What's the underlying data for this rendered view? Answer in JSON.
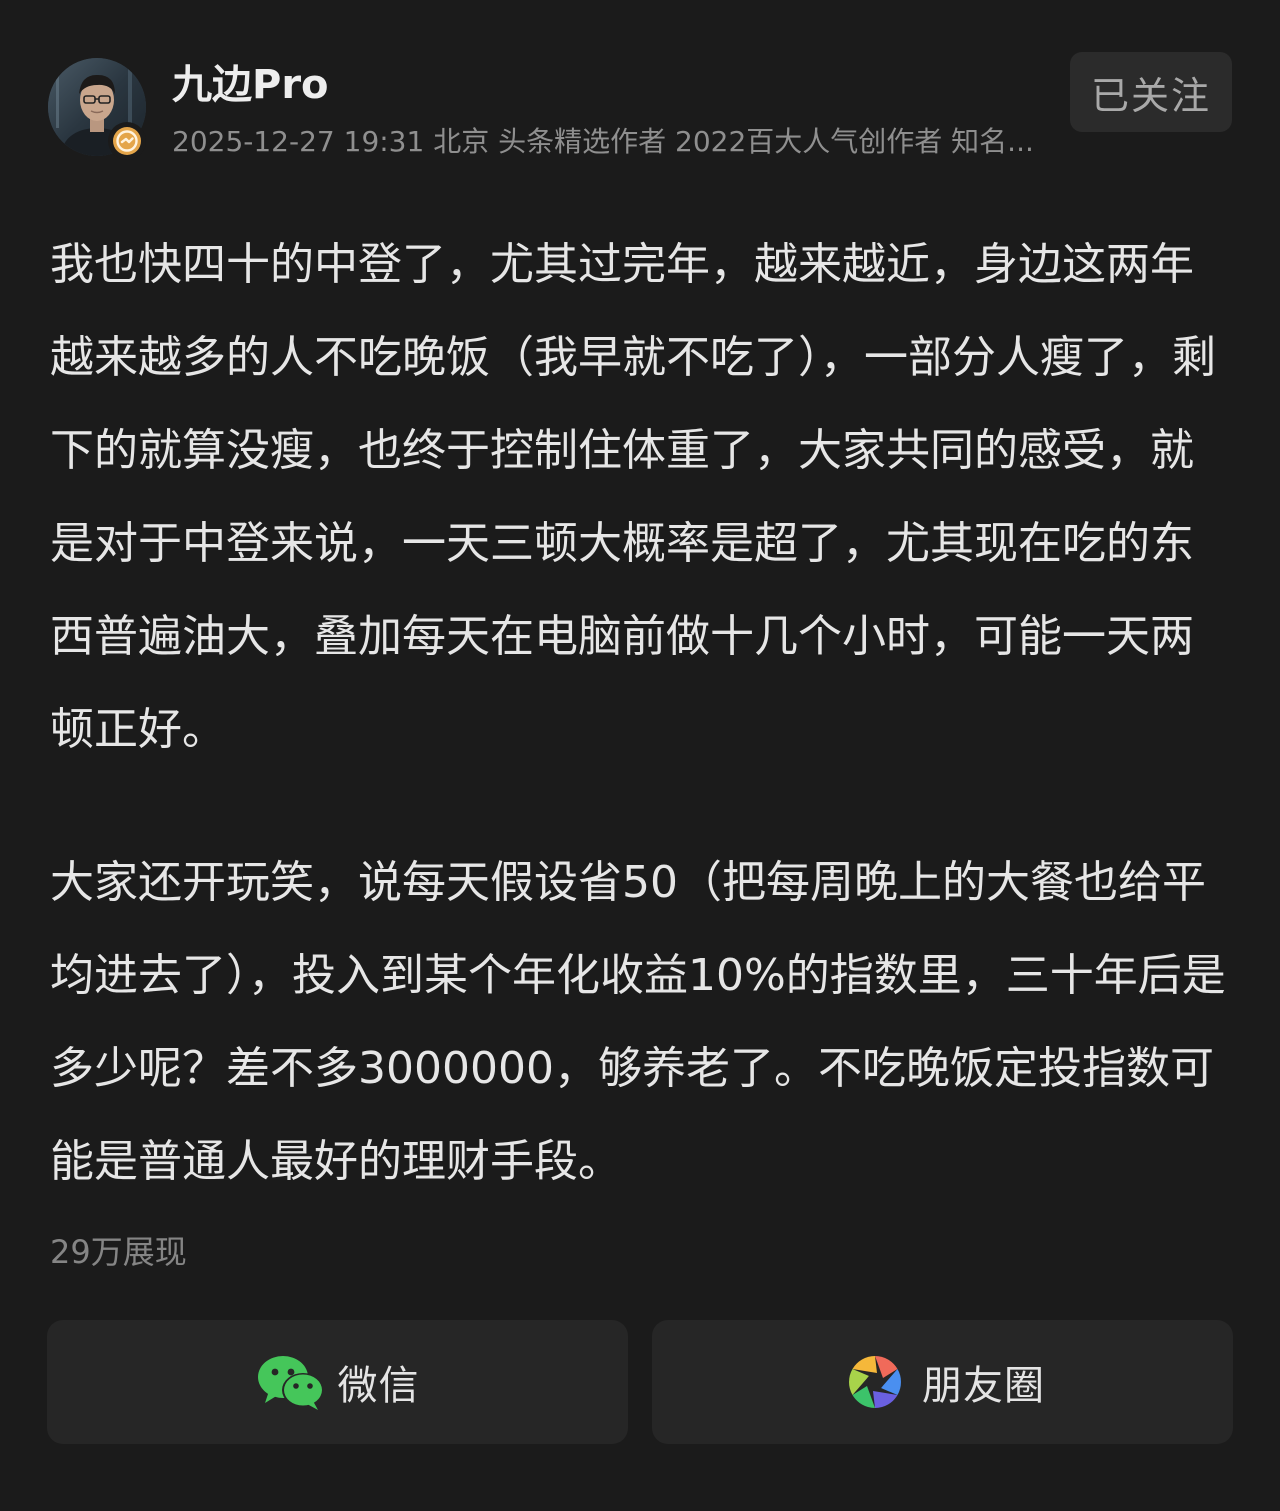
{
  "author": {
    "name": "九边Pro",
    "meta": "2025-12-27 19:31 北京 头条精选作者 2022百大人气创作者 知名...",
    "avatar_icon": "user-avatar",
    "badge_icon": "verified-badge-icon",
    "badge_color": "#e4a54a"
  },
  "follow_button": {
    "label": "已关注"
  },
  "post": {
    "paragraphs": [
      "我也快四十的中登了，尤其过完年，越来越近，身边这两年越来越多的人不吃晚饭（我早就不吃了），一部分人瘦了，剩下的就算没瘦，也终于控制住体重了，大家共同的感受，就是对于中登来说，一天三顿大概率是超了，尤其现在吃的东西普遍油大，叠加每天在电脑前做十几个小时，可能一天两顿正好。",
      "大家还开玩笑，说每天假设省50（把每周晚上的大餐也给平均进去了），投入到某个年化收益10%的指数里，三十年后是多少呢？差不多3000000，够养老了。不吃晚饭定投指数可能是普通人最好的理财手段。"
    ],
    "views": "29万展现"
  },
  "share": {
    "wechat_label": "微信",
    "wechat_icon": "wechat-icon",
    "wechat_color": "#45c65a",
    "moments_label": "朋友圈",
    "moments_icon": "moments-shutter-icon"
  }
}
